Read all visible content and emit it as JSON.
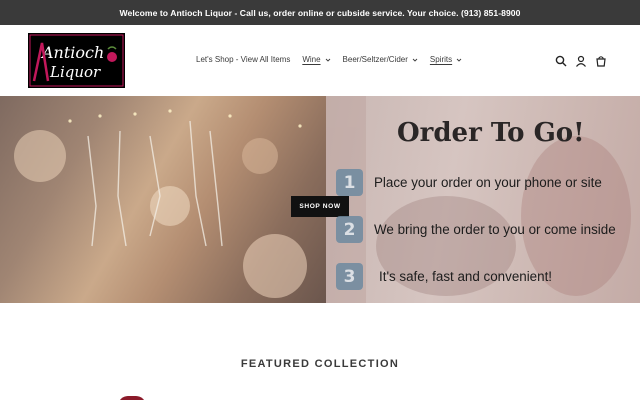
{
  "announcement": {
    "text": "Welcome to Antioch Liquor - Call us, order online or cubside service. Your choice. (913) 851-8900"
  },
  "header": {
    "logo_text_line1": "Antioch",
    "logo_text_line2": "Liquor",
    "nav": [
      {
        "label": "Let's Shop - View All Items",
        "has_dropdown": false,
        "underlined": false
      },
      {
        "label": "Wine",
        "has_dropdown": true,
        "underlined": true
      },
      {
        "label": "Beer/Seltzer/Cider",
        "has_dropdown": true,
        "underlined": false
      },
      {
        "label": "Spirits",
        "has_dropdown": true,
        "underlined": true
      }
    ],
    "icons": [
      "search-icon",
      "account-icon",
      "cart-icon"
    ]
  },
  "hero": {
    "button_label": "SHOP NOW",
    "title": "Order To Go!",
    "steps": [
      {
        "number": "1",
        "text": "Place your order on your phone or site"
      },
      {
        "number": "2",
        "text": "We bring the order to you or come inside"
      },
      {
        "number": "3",
        "text": "It's safe, fast and convenient!"
      }
    ]
  },
  "featured": {
    "title": "FEATURED COLLECTION"
  },
  "colors": {
    "announcement_bg": "#3a3a3a",
    "button_bg": "#111111",
    "step_badge": "#6e8aa0",
    "logo_accent": "#c2185b"
  }
}
